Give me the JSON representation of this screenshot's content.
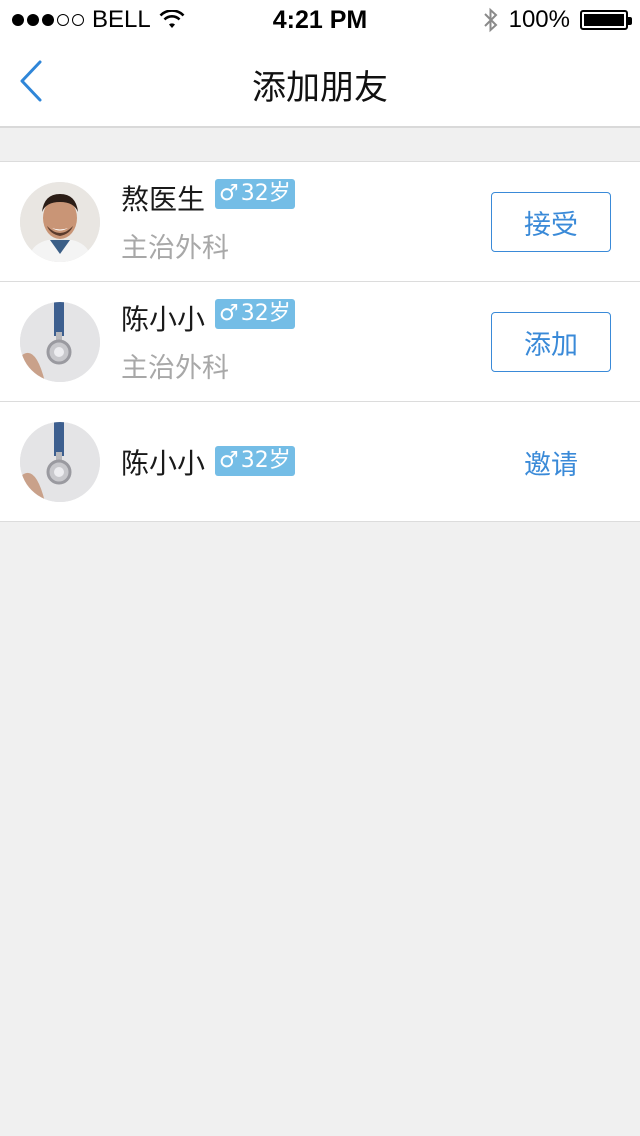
{
  "status_bar": {
    "carrier": "BELL",
    "time": "4:21 PM",
    "battery": "100%"
  },
  "nav": {
    "title": "添加朋友"
  },
  "friends": [
    {
      "name": "熬医生",
      "gender_icon": "♂",
      "age": "32岁",
      "subtitle": "主治外科",
      "action": "接受",
      "action_style": "outline"
    },
    {
      "name": "陈小小",
      "gender_icon": "♂",
      "age": "32岁",
      "subtitle": "主治外科",
      "action": "添加",
      "action_style": "outline"
    },
    {
      "name": "陈小小",
      "gender_icon": "♂",
      "age": "32岁",
      "subtitle": "",
      "action": "邀请",
      "action_style": "text"
    }
  ],
  "colors": {
    "accent": "#3a8ad8",
    "badge": "#74bde6",
    "background": "#f0f0f0"
  }
}
